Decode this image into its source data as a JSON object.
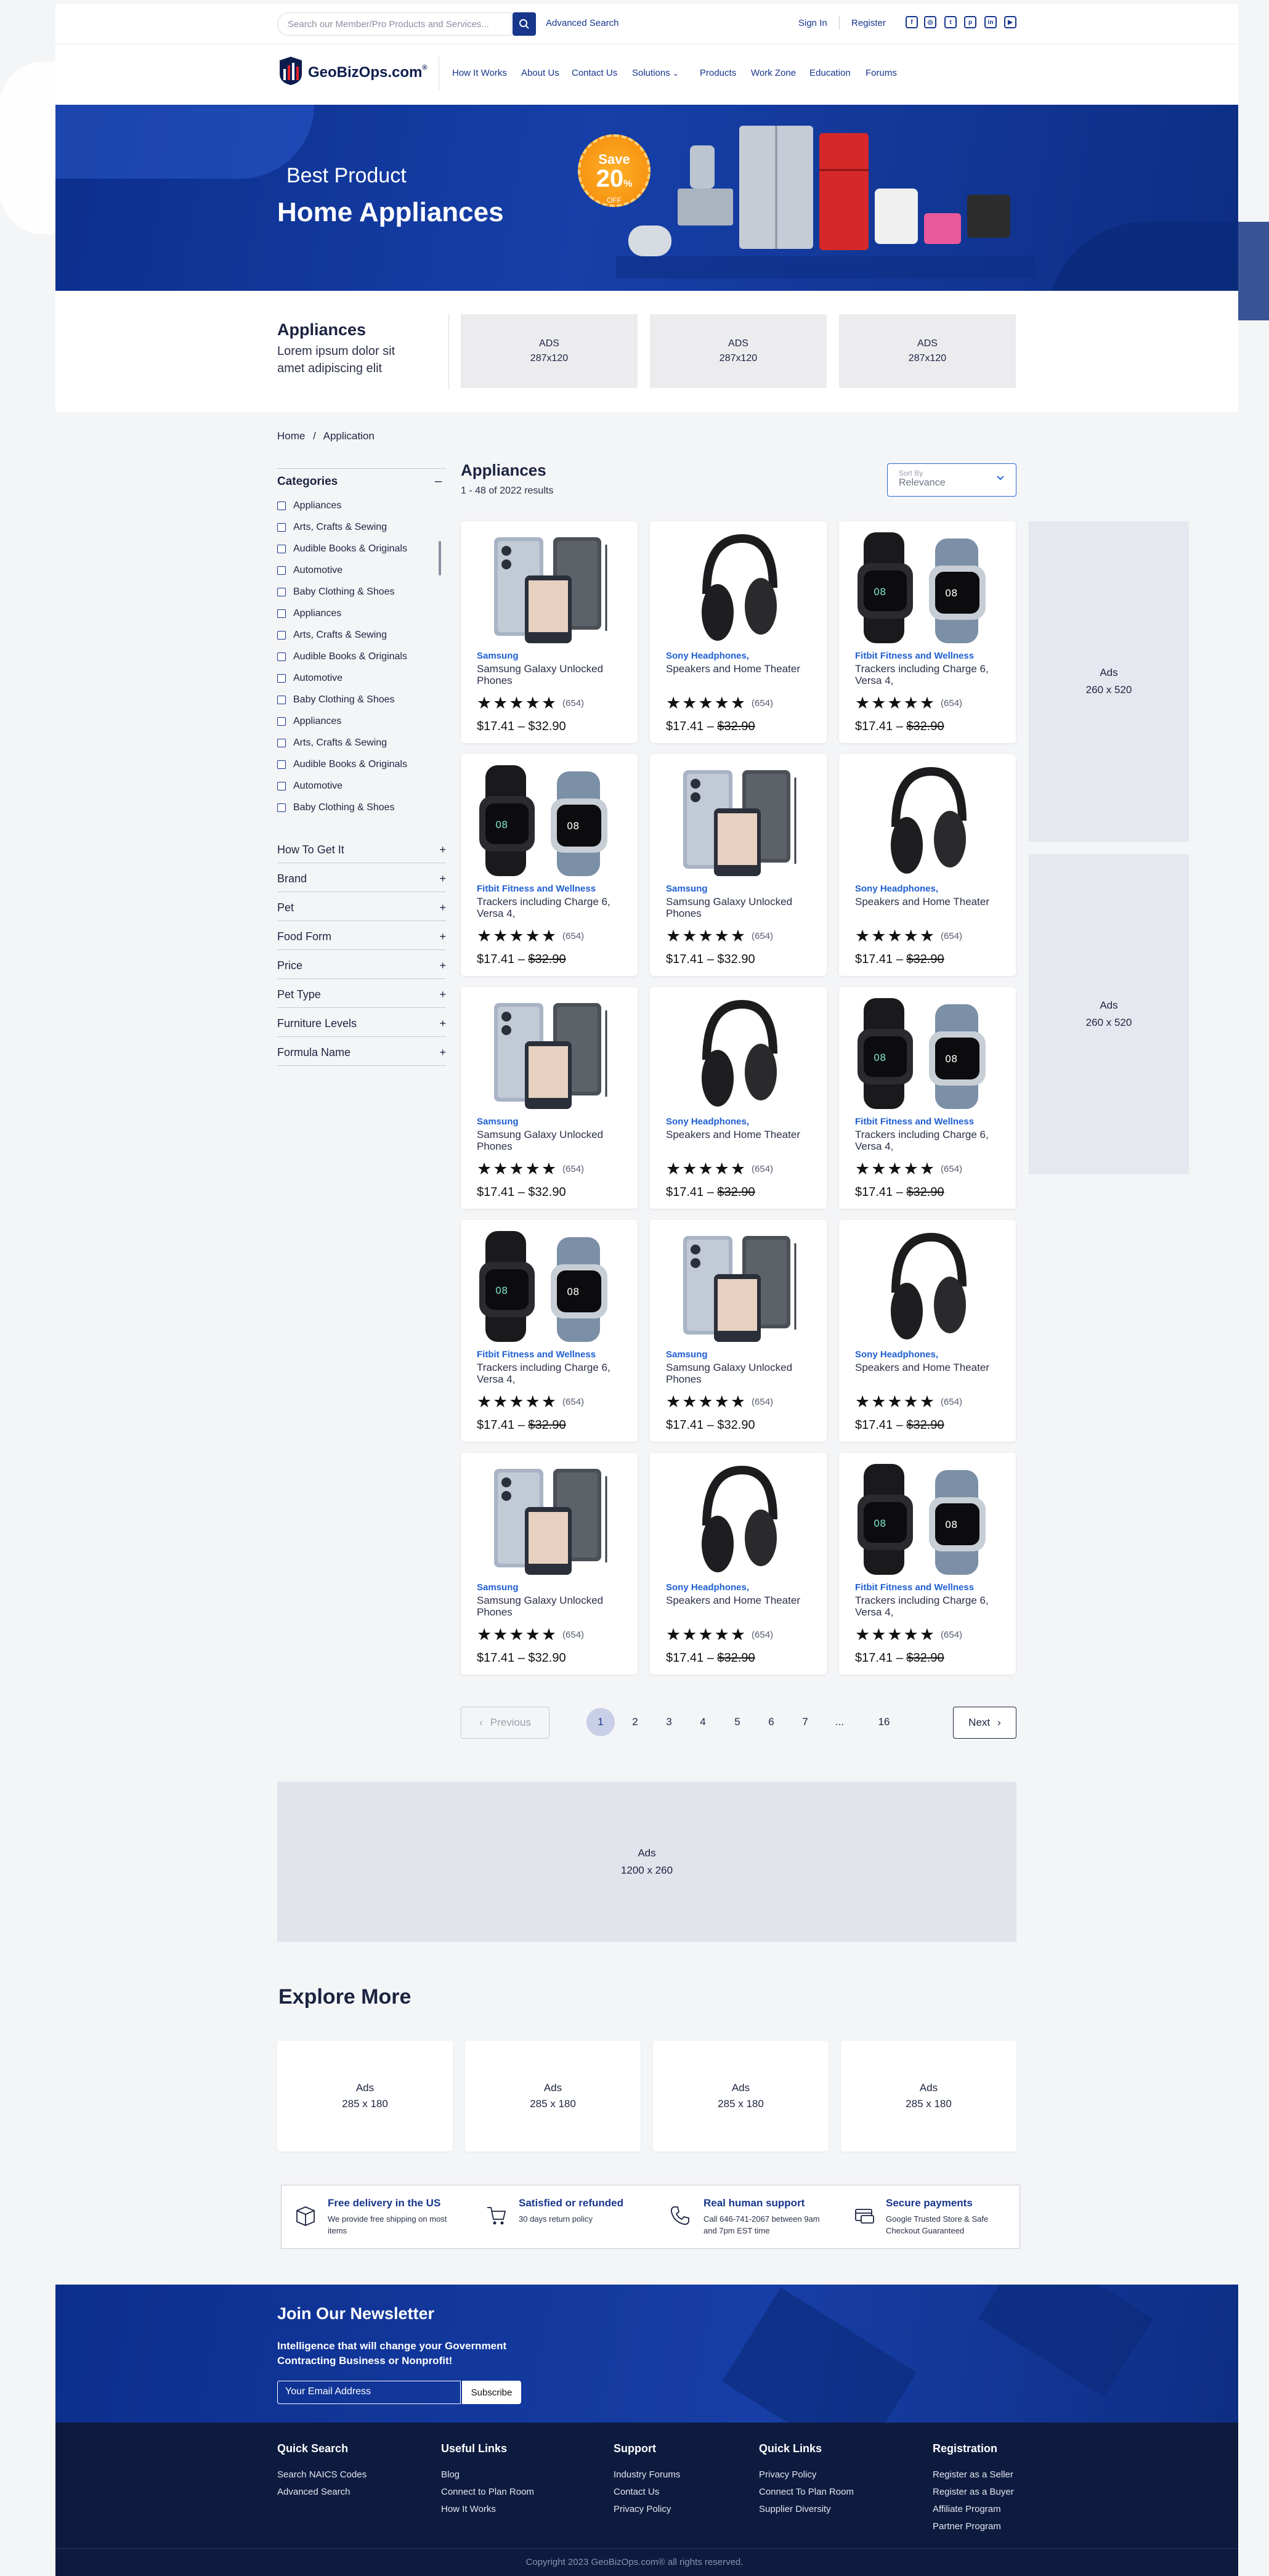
{
  "topbar": {
    "search_placeholder": "Search our Member/Pro Products and Services...",
    "advanced_search": "Advanced Search",
    "sign_in": "Sign In",
    "register": "Register",
    "social_icons": [
      "facebook-icon",
      "instagram-icon",
      "twitter-icon",
      "pinterest-icon",
      "linkedin-icon",
      "youtube-icon"
    ]
  },
  "nav": {
    "logo": "GeoBizOps.com",
    "logo_mark": "®",
    "items": [
      "How It Works",
      "About Us",
      "Contact Us",
      "Solutions",
      "Products",
      "Work Zone",
      "Education",
      "Forums"
    ]
  },
  "hero": {
    "subtitle": "Best Product",
    "title": "Home Appliances",
    "badge_line1": "Save",
    "badge_line2": "20",
    "badge_pct": "%",
    "badge_off": "OFF"
  },
  "category_box": {
    "title": "Appliances",
    "description": "Lorem ipsum dolor sit amet adipiscing elit",
    "ads": [
      {
        "label": "ADS",
        "size": "287x120"
      },
      {
        "label": "ADS",
        "size": "287x120"
      },
      {
        "label": "ADS",
        "size": "287x120"
      }
    ]
  },
  "breadcrumb": {
    "home": "Home",
    "sep": "/",
    "current": "Application"
  },
  "sidebar": {
    "categories_title": "Categories",
    "collapse_symbol": "–",
    "categories": [
      "Appliances",
      "Arts, Crafts & Sewing",
      "Audible Books & Originals",
      "Automotive",
      "Baby Clothing & Shoes",
      "Appliances",
      "Arts, Crafts & Sewing",
      "Audible Books & Originals",
      "Automotive",
      "Baby Clothing & Shoes",
      "Appliances",
      "Arts, Crafts & Sewing",
      "Audible Books & Originals",
      "Automotive",
      "Baby Clothing & Shoes"
    ],
    "filters": [
      "How To Get It",
      "Brand",
      "Pet",
      "Food Form",
      "Price",
      "Pet Type",
      "Furniture Levels",
      "Formula Name"
    ],
    "expand_symbol": "+"
  },
  "listing": {
    "title": "Appliances",
    "count": "1 - 48 of 2022 results",
    "sort_label": "Sort By",
    "sort_value": "Relevance"
  },
  "products": [
    {
      "kind": "phone",
      "brand": "Samsung",
      "name": "Samsung Galaxy Unlocked Phones",
      "stars": "★★★★★",
      "reviews": "(654)",
      "price_low": "$17.41",
      "dash": " – ",
      "price_high": "$32.90",
      "strike": false
    },
    {
      "kind": "headphones",
      "brand": "Sony Headphones,",
      "name": "Speakers and Home Theater",
      "stars": "★★★★★",
      "reviews": "(654)",
      "price_low": "$17.41",
      "dash": " – ",
      "price_high": "$32.90",
      "strike": true
    },
    {
      "kind": "watch",
      "brand": "Fitbit Fitness and Wellness",
      "name": "Trackers including Charge 6, Versa 4,",
      "stars": "★★★★★",
      "reviews": "(654)",
      "price_low": "$17.41",
      "dash": " – ",
      "price_high": "$32.90",
      "strike": true
    },
    {
      "kind": "watch",
      "brand": "Fitbit Fitness and Wellness",
      "name": "Trackers including Charge 6, Versa 4,",
      "stars": "★★★★★",
      "reviews": "(654)",
      "price_low": "$17.41",
      "dash": " – ",
      "price_high": "$32.90",
      "strike": true
    },
    {
      "kind": "phone",
      "brand": "Samsung",
      "name": "Samsung Galaxy Unlocked Phones",
      "stars": "★★★★★",
      "reviews": "(654)",
      "price_low": "$17.41",
      "dash": " – ",
      "price_high": "$32.90",
      "strike": false
    },
    {
      "kind": "headphones",
      "brand": "Sony Headphones,",
      "name": "Speakers and Home Theater",
      "stars": "★★★★★",
      "reviews": "(654)",
      "price_low": "$17.41",
      "dash": " – ",
      "price_high": "$32.90",
      "strike": true
    },
    {
      "kind": "phone",
      "brand": "Samsung",
      "name": "Samsung Galaxy Unlocked Phones",
      "stars": "★★★★★",
      "reviews": "(654)",
      "price_low": "$17.41",
      "dash": " – ",
      "price_high": "$32.90",
      "strike": false
    },
    {
      "kind": "headphones",
      "brand": "Sony Headphones,",
      "name": "Speakers and Home Theater",
      "stars": "★★★★★",
      "reviews": "(654)",
      "price_low": "$17.41",
      "dash": " – ",
      "price_high": "$32.90",
      "strike": true
    },
    {
      "kind": "watch",
      "brand": "Fitbit Fitness and Wellness",
      "name": "Trackers including Charge 6, Versa 4,",
      "stars": "★★★★★",
      "reviews": "(654)",
      "price_low": "$17.41",
      "dash": " – ",
      "price_high": "$32.90",
      "strike": true
    },
    {
      "kind": "watch",
      "brand": "Fitbit Fitness and Wellness",
      "name": "Trackers including Charge 6, Versa 4,",
      "stars": "★★★★★",
      "reviews": "(654)",
      "price_low": "$17.41",
      "dash": " – ",
      "price_high": "$32.90",
      "strike": true
    },
    {
      "kind": "phone",
      "brand": "Samsung",
      "name": "Samsung Galaxy Unlocked Phones",
      "stars": "★★★★★",
      "reviews": "(654)",
      "price_low": "$17.41",
      "dash": " – ",
      "price_high": "$32.90",
      "strike": false
    },
    {
      "kind": "headphones",
      "brand": "Sony Headphones,",
      "name": "Speakers and Home Theater",
      "stars": "★★★★★",
      "reviews": "(654)",
      "price_low": "$17.41",
      "dash": " – ",
      "price_high": "$32.90",
      "strike": true
    },
    {
      "kind": "phone",
      "brand": "Samsung",
      "name": "Samsung Galaxy Unlocked Phones",
      "stars": "★★★★★",
      "reviews": "(654)",
      "price_low": "$17.41",
      "dash": " – ",
      "price_high": "$32.90",
      "strike": false
    },
    {
      "kind": "headphones",
      "brand": "Sony Headphones,",
      "name": "Speakers and Home Theater",
      "stars": "★★★★★",
      "reviews": "(654)",
      "price_low": "$17.41",
      "dash": " – ",
      "price_high": "$32.90",
      "strike": true
    },
    {
      "kind": "watch",
      "brand": "Fitbit Fitness and Wellness",
      "name": "Trackers including Charge 6, Versa 4,",
      "stars": "★★★★★",
      "reviews": "(654)",
      "price_low": "$17.41",
      "dash": " – ",
      "price_high": "$32.90",
      "strike": true
    }
  ],
  "side_ads": [
    {
      "label": "Ads",
      "size": "260 x 520"
    },
    {
      "label": "Ads",
      "size": "260 x 520"
    }
  ],
  "pagination": {
    "previous": "Previous",
    "next": "Next",
    "pages": [
      "1",
      "2",
      "3",
      "4",
      "5",
      "6",
      "7",
      "...",
      "16"
    ],
    "active": "1"
  },
  "big_ad": {
    "label": "Ads",
    "size": "1200 x 260"
  },
  "explore": {
    "title": "Explore More",
    "ads": [
      {
        "label": "Ads",
        "size": "285 x 180"
      },
      {
        "label": "Ads",
        "size": "285 x 180"
      },
      {
        "label": "Ads",
        "size": "285 x 180"
      },
      {
        "label": "Ads",
        "size": "285 x 180"
      }
    ]
  },
  "features": [
    {
      "icon": "box-icon",
      "title": "Free delivery in the US",
      "desc": "We provide free shipping on most items"
    },
    {
      "icon": "cart-icon",
      "title": "Satisfied or refunded",
      "desc": "30 days return policy"
    },
    {
      "icon": "phone-icon",
      "title": "Real human support",
      "desc": "Call 646-741-2067 between 9am and 7pm EST time"
    },
    {
      "icon": "card-icon",
      "title": "Secure payments",
      "desc": "Google Trusted Store & Safe Checkout Guaranteed"
    }
  ],
  "newsletter": {
    "title": "Join Our Newsletter",
    "desc": "Intelligence that will change your Government Contracting Business or Nonprofit!",
    "placeholder": "Your Email Address",
    "button": "Subscribe"
  },
  "footer": {
    "columns": [
      {
        "title": "Quick Search",
        "links": [
          "Search NAICS Codes",
          "Advanced Search"
        ]
      },
      {
        "title": "Useful Links",
        "links": [
          "Blog",
          "Connect to Plan Room",
          "How It Works"
        ]
      },
      {
        "title": "Support",
        "links": [
          "Industry Forums",
          "Contact Us",
          "Privacy Policy"
        ]
      },
      {
        "title": "Quick Links",
        "links": [
          "Privacy Policy",
          "Connect To Plan Room",
          "Supplier Diversity"
        ]
      },
      {
        "title": "Registration",
        "links": [
          "Register as a Seller",
          "Register as a Buyer",
          "Affiliate Program",
          "Partner Program"
        ]
      }
    ],
    "copyright": "Copyright 2023 GeoBizOps.com® all rights reserved."
  },
  "colors": {
    "brand": "#17368c",
    "accent_link": "#1f5fd1",
    "hero": "#163fa8",
    "footer": "#0d1b3f",
    "badge": "#f48a0a"
  }
}
